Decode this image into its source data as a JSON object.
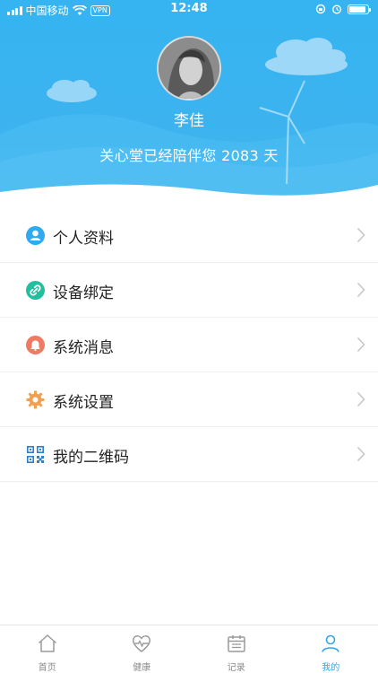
{
  "status_bar": {
    "carrier": "中国移动",
    "vpn": "VPN",
    "time": "12:48",
    "battery_level": 0.9
  },
  "profile": {
    "name": "李佳",
    "companion_text": "关心堂已经陪伴您 2083 天"
  },
  "menu": {
    "items": [
      {
        "label": "个人资料",
        "icon": "person-icon",
        "color": "#2eaaf0"
      },
      {
        "label": "设备绑定",
        "icon": "link-icon",
        "color": "#1fbf9f"
      },
      {
        "label": "系统消息",
        "icon": "bell-icon",
        "color": "#f07a62"
      },
      {
        "label": "系统设置",
        "icon": "gear-icon",
        "color": "#f0a050"
      },
      {
        "label": "我的二维码",
        "icon": "qr-code-icon",
        "color": "#2f80c8"
      }
    ]
  },
  "tabbar": {
    "tabs": [
      {
        "label": "首页",
        "icon": "home-icon",
        "active": false
      },
      {
        "label": "健康",
        "icon": "heart-pulse-icon",
        "active": false
      },
      {
        "label": "记录",
        "icon": "calendar-icon",
        "active": false
      },
      {
        "label": "我的",
        "icon": "user-icon",
        "active": true
      }
    ]
  },
  "colors": {
    "header_blue": "#35b4f1",
    "active_tab": "#2fa6ea",
    "chevron": "#c7c7cc"
  }
}
